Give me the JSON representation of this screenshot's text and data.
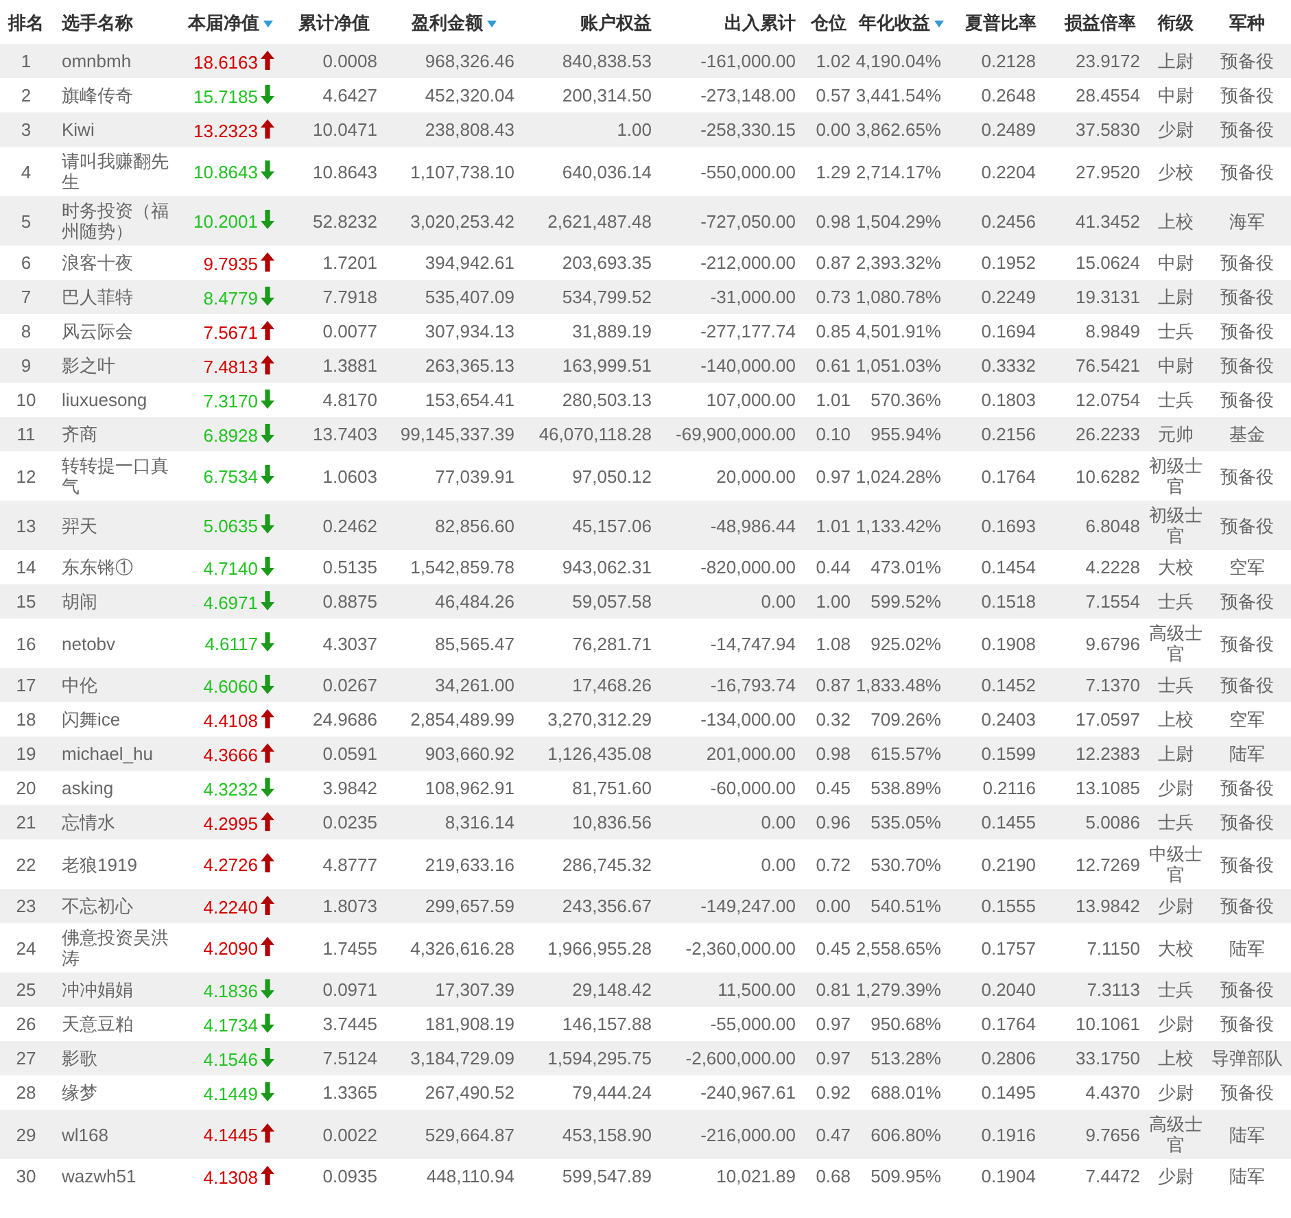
{
  "table": {
    "columns": [
      {
        "label": "排名",
        "sortable": false
      },
      {
        "label": "选手名称",
        "sortable": false
      },
      {
        "label": "本届净值",
        "sortable": true
      },
      {
        "label": "累计净值",
        "sortable": false
      },
      {
        "label": "盈利金额",
        "sortable": true
      },
      {
        "label": "账户权益",
        "sortable": false
      },
      {
        "label": "出入累计",
        "sortable": false
      },
      {
        "label": "仓位",
        "sortable": false
      },
      {
        "label": "年化收益",
        "sortable": true
      },
      {
        "label": "夏普比率",
        "sortable": false
      },
      {
        "label": "损益倍率",
        "sortable": false
      },
      {
        "label": "衔级",
        "sortable": false
      },
      {
        "label": "军种",
        "sortable": false
      }
    ],
    "rows": [
      {
        "cells": [
          "1",
          "omnbmh",
          "18.6163",
          "0.0008",
          "968,326.46",
          "840,838.53",
          "-161,000.00",
          "1.02",
          "4,190.04%",
          "0.2128",
          "23.9172",
          "上尉",
          "预备役"
        ],
        "kind": "up"
      },
      {
        "cells": [
          "2",
          "旗峰传奇",
          "15.7185",
          "4.6427",
          "452,320.04",
          "200,314.50",
          "-273,148.00",
          "0.57",
          "3,441.54%",
          "0.2648",
          "28.4554",
          "中尉",
          "预备役"
        ],
        "kind": "down"
      },
      {
        "cells": [
          "3",
          "Kiwi",
          "13.2323",
          "10.0471",
          "238,808.43",
          "1.00",
          "-258,330.15",
          "0.00",
          "3,862.65%",
          "0.2489",
          "37.5830",
          "少尉",
          "预备役"
        ],
        "kind": "up"
      },
      {
        "cells": [
          "4",
          "请叫我赚翻先生",
          "10.8643",
          "10.8643",
          "1,107,738.10",
          "640,036.14",
          "-550,000.00",
          "1.29",
          "2,714.17%",
          "0.2204",
          "27.9520",
          "少校",
          "预备役"
        ],
        "kind": "down"
      },
      {
        "cells": [
          "5",
          "时务投资（福州随势）",
          "10.2001",
          "52.8232",
          "3,020,253.42",
          "2,621,487.48",
          "-727,050.00",
          "0.98",
          "1,504.29%",
          "0.2456",
          "41.3452",
          "上校",
          "海军"
        ],
        "kind": "down"
      },
      {
        "cells": [
          "6",
          "浪客十夜",
          "9.7935",
          "1.7201",
          "394,942.61",
          "203,693.35",
          "-212,000.00",
          "0.87",
          "2,393.32%",
          "0.1952",
          "15.0624",
          "中尉",
          "预备役"
        ],
        "kind": "up"
      },
      {
        "cells": [
          "7",
          "巴人菲特",
          "8.4779",
          "7.7918",
          "535,407.09",
          "534,799.52",
          "-31,000.00",
          "0.73",
          "1,080.78%",
          "0.2249",
          "19.3131",
          "上尉",
          "预备役"
        ],
        "kind": "down"
      },
      {
        "cells": [
          "8",
          "风云际会",
          "7.5671",
          "0.0077",
          "307,934.13",
          "31,889.19",
          "-277,177.74",
          "0.85",
          "4,501.91%",
          "0.1694",
          "8.9849",
          "士兵",
          "预备役"
        ],
        "kind": "up"
      },
      {
        "cells": [
          "9",
          "影之叶",
          "7.4813",
          "1.3881",
          "263,365.13",
          "163,999.51",
          "-140,000.00",
          "0.61",
          "1,051.03%",
          "0.3332",
          "76.5421",
          "中尉",
          "预备役"
        ],
        "kind": "up"
      },
      {
        "cells": [
          "10",
          "liuxuesong",
          "7.3170",
          "4.8170",
          "153,654.41",
          "280,503.13",
          "107,000.00",
          "1.01",
          "570.36%",
          "0.1803",
          "12.0754",
          "士兵",
          "预备役"
        ],
        "kind": "down"
      },
      {
        "cells": [
          "11",
          "齐商",
          "6.8928",
          "13.7403",
          "99,145,337.39",
          "46,070,118.28",
          "-69,900,000.00",
          "0.10",
          "955.94%",
          "0.2156",
          "26.2233",
          "元帅",
          "基金"
        ],
        "kind": "down"
      },
      {
        "cells": [
          "12",
          "转转提一口真气",
          "6.7534",
          "1.0603",
          "77,039.91",
          "97,050.12",
          "20,000.00",
          "0.97",
          "1,024.28%",
          "0.1764",
          "10.6282",
          "初级士官",
          "预备役"
        ],
        "kind": "down"
      },
      {
        "cells": [
          "13",
          "羿天",
          "5.0635",
          "0.2462",
          "82,856.60",
          "45,157.06",
          "-48,986.44",
          "1.01",
          "1,133.42%",
          "0.1693",
          "6.8048",
          "初级士官",
          "预备役"
        ],
        "kind": "down"
      },
      {
        "cells": [
          "14",
          "东东锵①",
          "4.7140",
          "0.5135",
          "1,542,859.78",
          "943,062.31",
          "-820,000.00",
          "0.44",
          "473.01%",
          "0.1454",
          "4.2228",
          "大校",
          "空军"
        ],
        "kind": "down"
      },
      {
        "cells": [
          "15",
          "胡闹",
          "4.6971",
          "0.8875",
          "46,484.26",
          "59,057.58",
          "0.00",
          "1.00",
          "599.52%",
          "0.1518",
          "7.1554",
          "士兵",
          "预备役"
        ],
        "kind": "down"
      },
      {
        "cells": [
          "16",
          "netobv",
          "4.6117",
          "4.3037",
          "85,565.47",
          "76,281.71",
          "-14,747.94",
          "1.08",
          "925.02%",
          "0.1908",
          "9.6796",
          "高级士官",
          "预备役"
        ],
        "kind": "down"
      },
      {
        "cells": [
          "17",
          "中伦",
          "4.6060",
          "0.0267",
          "34,261.00",
          "17,468.26",
          "-16,793.74",
          "0.87",
          "1,833.48%",
          "0.1452",
          "7.1370",
          "士兵",
          "预备役"
        ],
        "kind": "down"
      },
      {
        "cells": [
          "18",
          "闪舞ice",
          "4.4108",
          "24.9686",
          "2,854,489.99",
          "3,270,312.29",
          "-134,000.00",
          "0.32",
          "709.26%",
          "0.2403",
          "17.0597",
          "上校",
          "空军"
        ],
        "kind": "up"
      },
      {
        "cells": [
          "19",
          "michael_hu",
          "4.3666",
          "0.0591",
          "903,660.92",
          "1,126,435.08",
          "201,000.00",
          "0.98",
          "615.57%",
          "0.1599",
          "12.2383",
          "上尉",
          "陆军"
        ],
        "kind": "up"
      },
      {
        "cells": [
          "20",
          "asking",
          "4.3232",
          "3.9842",
          "108,962.91",
          "81,751.60",
          "-60,000.00",
          "0.45",
          "538.89%",
          "0.2116",
          "13.1085",
          "少尉",
          "预备役"
        ],
        "kind": "down"
      },
      {
        "cells": [
          "21",
          "忘情水",
          "4.2995",
          "0.0235",
          "8,316.14",
          "10,836.56",
          "0.00",
          "0.96",
          "535.05%",
          "0.1455",
          "5.0086",
          "士兵",
          "预备役"
        ],
        "kind": "up"
      },
      {
        "cells": [
          "22",
          "老狼1919",
          "4.2726",
          "4.8777",
          "219,633.16",
          "286,745.32",
          "0.00",
          "0.72",
          "530.70%",
          "0.2190",
          "12.7269",
          "中级士官",
          "预备役"
        ],
        "kind": "up"
      },
      {
        "cells": [
          "23",
          "不忘初心",
          "4.2240",
          "1.8073",
          "299,657.59",
          "243,356.67",
          "-149,247.00",
          "0.00",
          "540.51%",
          "0.1555",
          "13.9842",
          "少尉",
          "预备役"
        ],
        "kind": "up"
      },
      {
        "cells": [
          "24",
          "佛意投资吴洪涛",
          "4.2090",
          "1.7455",
          "4,326,616.28",
          "1,966,955.28",
          "-2,360,000.00",
          "0.45",
          "2,558.65%",
          "0.1757",
          "7.1150",
          "大校",
          "陆军"
        ],
        "kind": "up"
      },
      {
        "cells": [
          "25",
          "冲冲娟娟",
          "4.1836",
          "0.0971",
          "17,307.39",
          "29,148.42",
          "11,500.00",
          "0.81",
          "1,279.39%",
          "0.2040",
          "7.3113",
          "士兵",
          "预备役"
        ],
        "kind": "down"
      },
      {
        "cells": [
          "26",
          "天意豆粕",
          "4.1734",
          "3.7445",
          "181,908.19",
          "146,157.88",
          "-55,000.00",
          "0.97",
          "950.68%",
          "0.1764",
          "10.1061",
          "少尉",
          "预备役"
        ],
        "kind": "down"
      },
      {
        "cells": [
          "27",
          "影歌",
          "4.1546",
          "7.5124",
          "3,184,729.09",
          "1,594,295.75",
          "-2,600,000.00",
          "0.97",
          "513.28%",
          "0.2806",
          "33.1750",
          "上校",
          "导弹部队"
        ],
        "kind": "down"
      },
      {
        "cells": [
          "28",
          "缘梦",
          "4.1449",
          "1.3365",
          "267,490.52",
          "79,444.24",
          "-240,967.61",
          "0.92",
          "688.01%",
          "0.1495",
          "4.4370",
          "少尉",
          "预备役"
        ],
        "kind": "down"
      },
      {
        "cells": [
          "29",
          "wl168",
          "4.1445",
          "0.0022",
          "529,664.87",
          "453,158.90",
          "-216,000.00",
          "0.47",
          "606.80%",
          "0.1916",
          "9.7656",
          "高级士官",
          "陆军"
        ],
        "kind": "up"
      },
      {
        "cells": [
          "30",
          "wazwh51",
          "4.1308",
          "0.0935",
          "448,110.94",
          "599,547.89",
          "10,021.89",
          "0.68",
          "509.95%",
          "0.1904",
          "7.4472",
          "少尉",
          "陆军"
        ],
        "kind": "up"
      }
    ]
  }
}
